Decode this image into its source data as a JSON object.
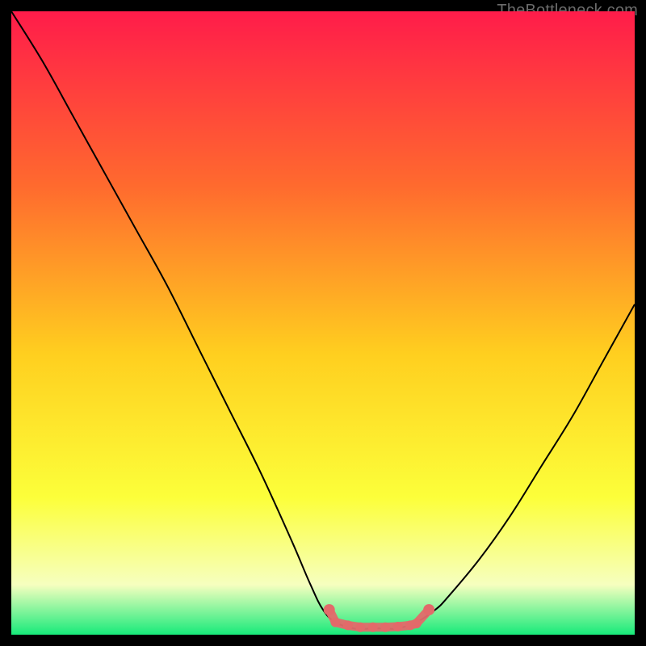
{
  "watermark": "TheBottleneck.com",
  "colors": {
    "gradient_top": "#ff1c4a",
    "gradient_upper_mid": "#ff6a2e",
    "gradient_mid": "#ffcf1f",
    "gradient_lower_mid": "#fcff3a",
    "gradient_pale": "#f6ffbf",
    "gradient_bottom": "#17ea7a",
    "curve": "#000000",
    "marker": "#e26a6a"
  },
  "chart_data": {
    "type": "line",
    "title": "",
    "xlabel": "",
    "ylabel": "",
    "x": [
      0.0,
      0.05,
      0.1,
      0.15,
      0.2,
      0.25,
      0.3,
      0.35,
      0.4,
      0.45,
      0.48,
      0.5,
      0.52,
      0.55,
      0.58,
      0.6,
      0.62,
      0.65,
      0.68,
      0.7,
      0.75,
      0.8,
      0.85,
      0.9,
      0.95,
      1.0
    ],
    "values": [
      1.0,
      0.92,
      0.83,
      0.74,
      0.65,
      0.56,
      0.46,
      0.36,
      0.26,
      0.15,
      0.08,
      0.04,
      0.02,
      0.01,
      0.01,
      0.01,
      0.01,
      0.02,
      0.04,
      0.06,
      0.12,
      0.19,
      0.27,
      0.35,
      0.44,
      0.53
    ],
    "xlim": [
      0,
      1
    ],
    "ylim": [
      0,
      1
    ],
    "markers": {
      "x": [
        0.51,
        0.52,
        0.54,
        0.56,
        0.58,
        0.6,
        0.62,
        0.64,
        0.65,
        0.67
      ],
      "values": [
        0.04,
        0.02,
        0.015,
        0.012,
        0.012,
        0.012,
        0.013,
        0.015,
        0.018,
        0.04
      ]
    }
  }
}
